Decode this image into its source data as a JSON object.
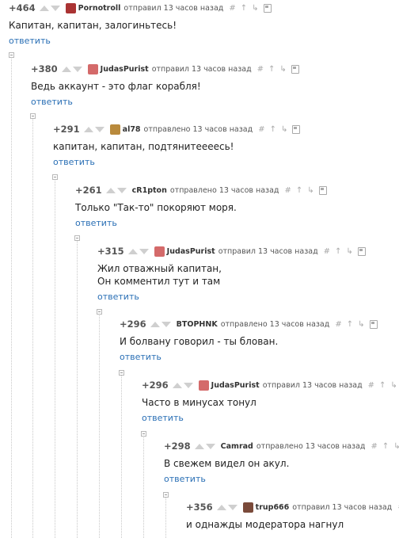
{
  "tools": {
    "hash": "#",
    "arrow_up": "↑",
    "branch": "↳"
  },
  "comments": [
    {
      "rating": "+464",
      "author": "Pornotroll",
      "meta": "отправил 13 часов назад",
      "text": "Капитан, капитан, залогиньтесь!",
      "reply": "ответить",
      "avatar_color": "#a33"
    },
    {
      "rating": "+380",
      "author": "JudasPurist",
      "meta": "отправил 13 часов назад",
      "text": "Ведь аккаунт - это флаг корабля!",
      "reply": "ответить",
      "avatar_color": "#d46a6a"
    },
    {
      "rating": "+291",
      "author": "al78",
      "meta": "отправлено 13 часов назад",
      "text": "капитан, капитан, подтянитеееесь!",
      "reply": "ответить",
      "avatar_color": "#b98a3c"
    },
    {
      "rating": "+261",
      "author": "cR1pton",
      "meta": "отправлено 13 часов назад",
      "text": "Только \"Так-то\" покоряют моря.",
      "reply": "ответить",
      "avatar_color": ""
    },
    {
      "rating": "+315",
      "author": "JudasPurist",
      "meta": "отправил 13 часов назад",
      "text": "Жил отважный капитан,",
      "text2": "Он комментил тут и там",
      "reply": "ответить",
      "avatar_color": "#d46a6a"
    },
    {
      "rating": "+296",
      "author": "ВТОРНNK",
      "meta": "отправлено 13 часов назад",
      "text": "И болвану говорил - ты блован.",
      "reply": "ответить",
      "avatar_color": ""
    },
    {
      "rating": "+296",
      "author": "JudasPurist",
      "meta": "отправил 13 часов назад",
      "text": "Часто в минусах тонул",
      "reply": "ответить",
      "avatar_color": "#d46a6a"
    },
    {
      "rating": "+298",
      "author": "Camrad",
      "meta": "отправлено 13 часов назад",
      "text": "В свежем видел он акул.",
      "reply": "ответить",
      "avatar_color": ""
    },
    {
      "rating": "+356",
      "author": "trup666",
      "meta": "отправил 13 часов назад",
      "text": "и однажды модератора нагнул",
      "reply": "",
      "avatar_color": "#7a4a3a"
    }
  ]
}
